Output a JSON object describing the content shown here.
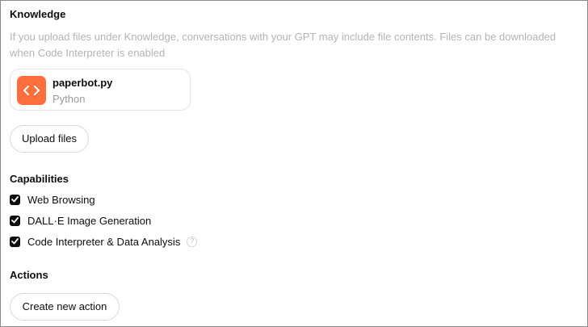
{
  "knowledge": {
    "title": "Knowledge",
    "description": "If you upload files under Knowledge, conversations with your GPT may include file contents. Files can be downloaded when Code Interpreter is enabled",
    "files": [
      {
        "name": "paperbot.py",
        "type": "Python",
        "icon": "code-icon",
        "icon_color": "#ff6e3c"
      }
    ],
    "upload_label": "Upload files"
  },
  "capabilities": {
    "title": "Capabilities",
    "items": [
      {
        "label": "Web Browsing",
        "checked": true
      },
      {
        "label": "DALL·E Image Generation",
        "checked": true
      },
      {
        "label": "Code Interpreter & Data Analysis",
        "checked": true,
        "help_icon": "?"
      }
    ]
  },
  "actions": {
    "title": "Actions",
    "create_label": "Create new action"
  }
}
